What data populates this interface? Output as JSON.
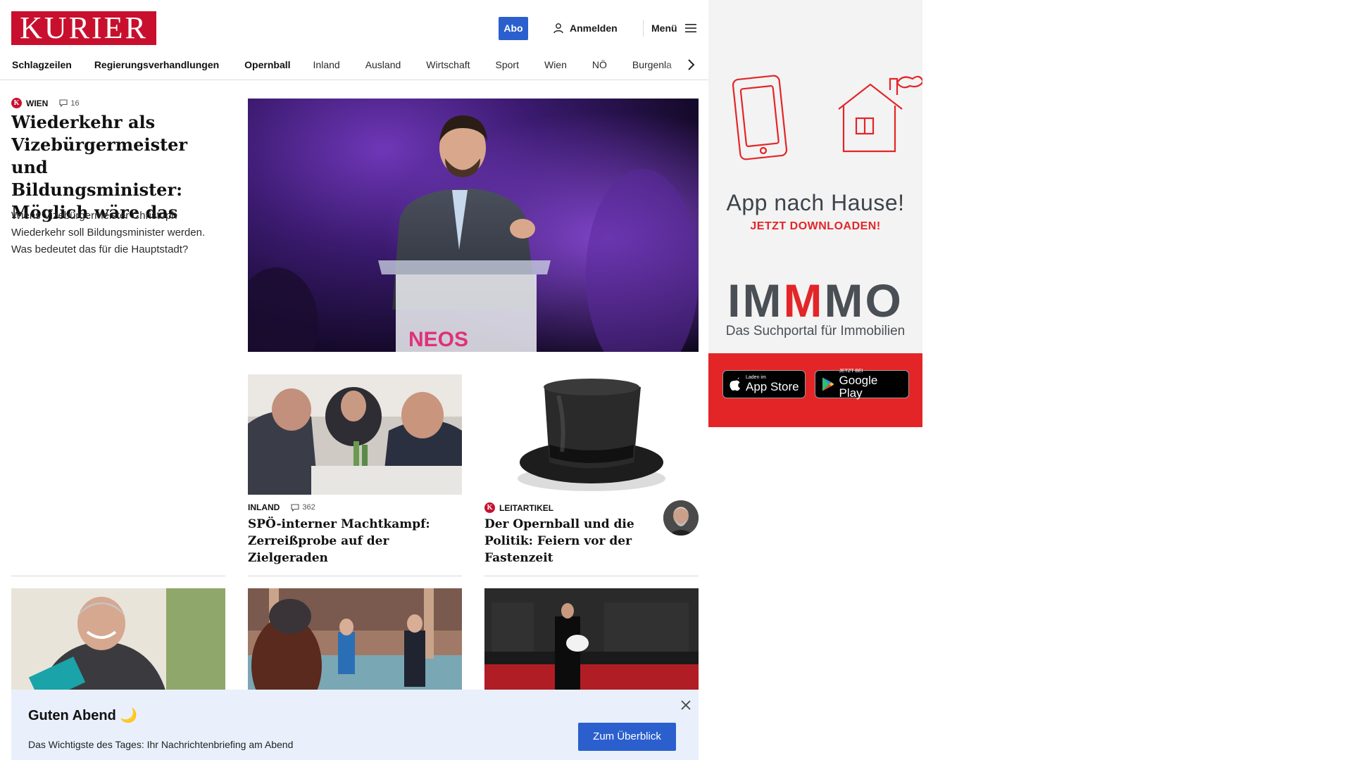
{
  "header": {
    "logo": "KURIER",
    "abo_label": "Abo",
    "login_label": "Anmelden",
    "menu_label": "Menü"
  },
  "nav": {
    "items": [
      "Schlagzeilen",
      "Regierungsverhandlungen",
      "Opernball",
      "Inland",
      "Ausland",
      "Wirtschaft",
      "Sport",
      "Wien",
      "NÖ",
      "Burgenla"
    ]
  },
  "lead": {
    "category": "WIEN",
    "comments": "16",
    "title": "Wiederkehr als Vizebürgermeister und Bildungsminister: Möglich wäre das",
    "teaser": "Wiens Vizebürgermeister Christoph Wiederkehr soll Bildungsminister werden. Was bedeutet das für die Hauptstadt?",
    "image_text": "NEOS"
  },
  "cards": [
    {
      "category": "INLAND",
      "comments": "362",
      "title": "SPÖ-interner Machtkampf: Zerreißprobe auf der Zielgeraden"
    },
    {
      "category": "LEITARTIKEL",
      "title": "Der Opernball und die Politik: Feiern vor der Fastenzeit"
    }
  ],
  "briefing": {
    "title": "Guten Abend 🌙",
    "text": "Das Wichtigste des Tages: Ihr Nachrichtenbriefing am Abend",
    "button": "Zum Überblick"
  },
  "ad": {
    "headline": "App nach Hause!",
    "subline": "JETZT DOWNLOADEN!",
    "brand_parts": [
      "IM",
      "M",
      "MO"
    ],
    "tagline": "Das Suchportal für Immobilien",
    "appstore_small": "Laden im",
    "appstore_big": "App Store",
    "googleplay_small": "JETZT BEI",
    "googleplay_big": "Google Play"
  },
  "colors": {
    "brand_red": "#c8102e",
    "accent_blue": "#2b5fce",
    "ad_red": "#e42528"
  }
}
